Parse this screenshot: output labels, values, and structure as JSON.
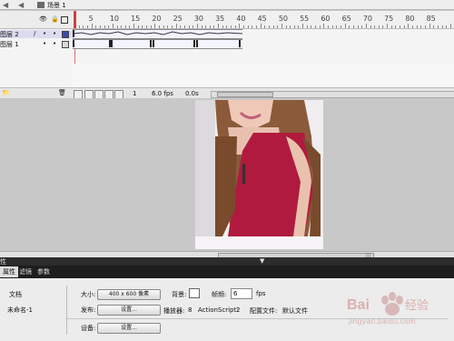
{
  "scene": {
    "label": "场景 1"
  },
  "timeline": {
    "ruler": [
      "5",
      "10",
      "15",
      "20",
      "25",
      "30",
      "35",
      "40",
      "45",
      "50",
      "55",
      "60",
      "65",
      "70",
      "75",
      "80",
      "85"
    ],
    "layers": [
      {
        "name": "图层 2",
        "active": true
      },
      {
        "name": "图层 1",
        "active": false
      }
    ],
    "status": {
      "frame": "1",
      "fps": "6.0 fps",
      "time": "0.0s"
    }
  },
  "properties": {
    "panel_label": "性",
    "tabs": [
      "属性",
      "滤镜",
      "参数"
    ],
    "doc_label": "文档",
    "doc_name": "未命名-1",
    "size_label": "大小:",
    "size_button": "400 x 600 像素",
    "bg_label": "背景:",
    "fps_label": "帧频:",
    "fps_value": "6",
    "fps_unit": "fps",
    "publish_label": "发布:",
    "settings_button": "设置...",
    "player_label": "播放器:",
    "player_value": "8",
    "as_label": "ActionScript:",
    "as_value": "2",
    "profile_label": "配置文件:",
    "profile_value": "默认文件",
    "device_label": "设备:",
    "device_button": "设置..."
  },
  "watermark": {
    "text": "Bai 经验",
    "sub": "jingyan.baidu.com"
  },
  "colors": {
    "panel_dark": "#2c2c2c",
    "stage_bg": "#c8c8c8",
    "dress": "#b01a3e"
  }
}
